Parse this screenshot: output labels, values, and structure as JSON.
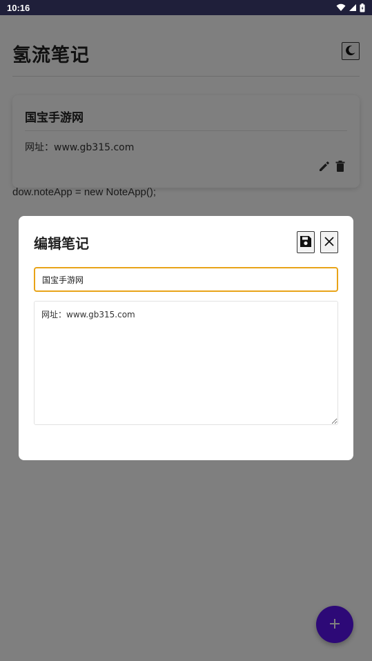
{
  "status_bar": {
    "time": "10:16",
    "icons": [
      "wifi-icon",
      "signal-icon",
      "battery-icon"
    ]
  },
  "app": {
    "title": "氢流笔记",
    "theme_toggle_icon": "moon-icon",
    "leaked_code": "dow.noteApp = new NoteApp();"
  },
  "notes": [
    {
      "title": "国宝手游网",
      "content": "网址：www.gb315.com"
    }
  ],
  "modal": {
    "title": "编辑笔记",
    "title_value": "国宝手游网",
    "content_value": "网址：www.gb315.com"
  },
  "colors": {
    "accent_focus": "#e8a317",
    "fab": "#5b12ee",
    "overlay": "rgba(0,0,0,0.5)",
    "status_bar": "#1f1f3a"
  }
}
